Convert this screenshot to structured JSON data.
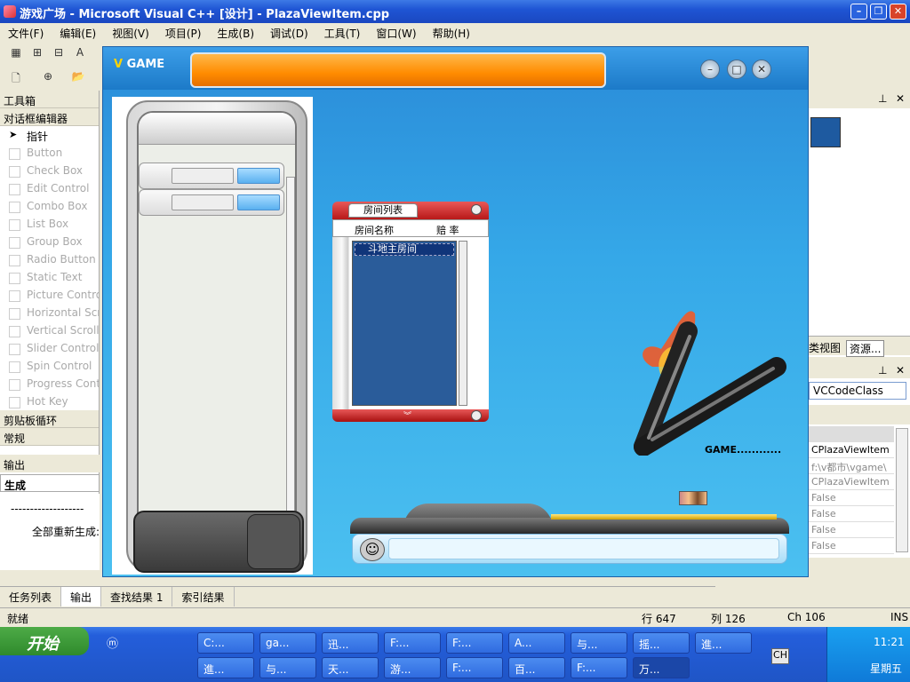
{
  "window": {
    "title": "游戏广场 - Microsoft Visual C++ [设计] - PlazaViewItem.cpp",
    "min_label": "–",
    "max_label": "❐",
    "close_label": "✕"
  },
  "menu": [
    "文件(F)",
    "编辑(E)",
    "视图(V)",
    "项目(P)",
    "生成(B)",
    "调试(D)",
    "工具(T)",
    "窗口(W)",
    "帮助(H)"
  ],
  "toolbox": {
    "title": "工具箱",
    "section": "对话框编辑器",
    "items": [
      "指针",
      "Button",
      "Check Box",
      "Edit Control",
      "Combo Box",
      "List Box",
      "Group Box",
      "Radio Button",
      "Static Text",
      "Picture Control",
      "Horizontal Scroll Bar",
      "Vertical Scroll Bar",
      "Slider Control",
      "Spin Control",
      "Progress Control",
      "Hot Key"
    ],
    "footer_sections": [
      "剪贴板循环",
      "常规"
    ]
  },
  "output": {
    "title": "输出",
    "subtitle": "生成",
    "line1": "-------------------",
    "line2": "全部重新生成:"
  },
  "bottom_tabs": [
    "任务列表",
    "输出",
    "查找结果 1",
    "索引结果"
  ],
  "status": {
    "ready": "就绪",
    "line": "行 647",
    "col": "列 126",
    "ch": "Ch 106",
    "ins": "INS"
  },
  "right_panel": {
    "tabs": [
      "类视图",
      "资源..."
    ],
    "class_select": "VCCodeClass",
    "props": [
      "CPlazaViewItem",
      "f:\\v都市\\vgame\\",
      "CPlazaViewItem",
      "False",
      "False",
      "False",
      "False",
      "False"
    ]
  },
  "game": {
    "logo_letter": "V",
    "logo_text": "GAME",
    "room_tab": "房间列表",
    "room_col1": "房间名称",
    "room_col2": "赔 率",
    "room_selected": "斗地主房间",
    "brand": "GAME............",
    "btn_min": "–",
    "btn_max": "□",
    "btn_close": "✕",
    "smile": "☺"
  },
  "taskbar": {
    "start": "开始",
    "tasks_row1": [
      "C:...",
      "ga...",
      "迅...",
      "F:...",
      "F:...",
      "A...",
      "与...",
      "摇...",
      "進..."
    ],
    "tasks_row2": [
      "進...",
      "与...",
      "天...",
      "游...",
      "F:...",
      "百...",
      "F:...",
      "万..."
    ],
    "active_task": "万...",
    "lang": "CH",
    "time": "11:21",
    "day": "星期五"
  },
  "colors": {
    "accent": "#245edb",
    "orange": "#ff8c00",
    "game_bg": "#35a8e8"
  }
}
